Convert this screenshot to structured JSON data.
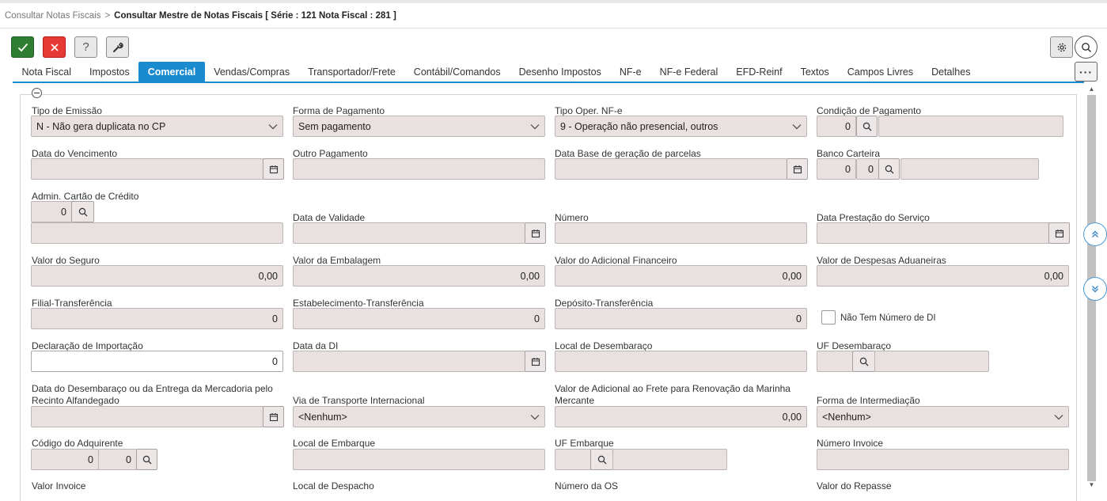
{
  "breadcrumb": {
    "parent": "Consultar Notas Fiscais",
    "separator": ">",
    "current": "Consultar Mestre de Notas Fiscais [ Série : 121 Nota Fiscal : 281 ]"
  },
  "toolbar": {
    "confirm_icon": "check-icon",
    "cancel_icon": "close-icon",
    "help_label": "?",
    "tool_icon": "wrench-icon",
    "settings_icon": "gear-icon",
    "search_icon": "search-icon",
    "more_label": "···",
    "colors": {
      "confirm": "#2e7d32",
      "cancel": "#e53935",
      "accent": "#1b8bd0"
    }
  },
  "tabs": [
    {
      "label": "Nota Fiscal"
    },
    {
      "label": "Impostos"
    },
    {
      "label": "Comercial",
      "active": true
    },
    {
      "label": "Vendas/Compras"
    },
    {
      "label": "Transportador/Frete"
    },
    {
      "label": "Contábil/Comandos"
    },
    {
      "label": "Desenho Impostos"
    },
    {
      "label": "NF-e"
    },
    {
      "label": "NF-e Federal"
    },
    {
      "label": "EFD-Reinf"
    },
    {
      "label": "Textos"
    },
    {
      "label": "Campos Livres"
    },
    {
      "label": "Detalhes"
    }
  ],
  "form": {
    "tipo_emissao": {
      "label": "Tipo de Emissão",
      "value": "N - Não gera duplicata no CP"
    },
    "forma_pagamento": {
      "label": "Forma de Pagamento",
      "value": "Sem pagamento"
    },
    "tipo_oper_nfe": {
      "label": "Tipo Oper. NF-e",
      "value": "9 - Operação não presencial, outros"
    },
    "condicao_pagamento": {
      "label": "Condição de Pagamento",
      "code": "0",
      "desc": ""
    },
    "data_vencimento": {
      "label": "Data do Vencimento",
      "value": ""
    },
    "outro_pagamento": {
      "label": "Outro Pagamento",
      "value": ""
    },
    "data_base_parcelas": {
      "label": "Data Base de geração de parcelas",
      "value": ""
    },
    "banco_carteira": {
      "label": "Banco Carteira",
      "banco": "0",
      "carteira": "0",
      "desc": ""
    },
    "admin_cartao": {
      "label": "Admin. Cartão de Crédito",
      "code": "0",
      "desc": ""
    },
    "data_validade": {
      "label": "Data de Validade",
      "value": ""
    },
    "numero": {
      "label": "Número",
      "value": ""
    },
    "data_prestacao": {
      "label": "Data Prestação do Serviço",
      "value": ""
    },
    "valor_seguro": {
      "label": "Valor do Seguro",
      "value": "0,00"
    },
    "valor_embalagem": {
      "label": "Valor da Embalagem",
      "value": "0,00"
    },
    "valor_adic_financeiro": {
      "label": "Valor do Adicional Financeiro",
      "value": "0,00"
    },
    "valor_despesas_aduaneiras": {
      "label": "Valor de Despesas Aduaneiras",
      "value": "0,00"
    },
    "filial_transferencia": {
      "label": "Filial-Transferência",
      "value": "0"
    },
    "estab_transferencia": {
      "label": "Estabelecimento-Transferência",
      "value": "0"
    },
    "deposito_transferencia": {
      "label": "Depósito-Transferência",
      "value": "0"
    },
    "nao_tem_numero_di": {
      "label": "Não Tem Número de DI",
      "checked": false
    },
    "declaracao_importacao": {
      "label": "Declaração de Importação",
      "value": "0"
    },
    "data_di": {
      "label": "Data da DI",
      "value": ""
    },
    "local_desembaraco": {
      "label": "Local de Desembaraço",
      "value": ""
    },
    "uf_desembaraco": {
      "label": "UF Desembaraço",
      "code": "",
      "desc": ""
    },
    "data_desembaraco": {
      "label_line1": "Data do Desembaraço ou da Entrega da Mercadoria pelo",
      "label_line2": "Recinto Alfandegado",
      "value": ""
    },
    "via_transporte": {
      "label": "Via de Transporte Internacional",
      "value": "<Nenhum>"
    },
    "valor_adic_frete": {
      "label_line1": "Valor de Adicional ao Frete para Renovação da Marinha",
      "label_line2": "Mercante",
      "value": "0,00"
    },
    "forma_intermediacao": {
      "label": "Forma de Intermediação",
      "value": "<Nenhum>"
    },
    "codigo_adquirente": {
      "label": "Código do Adquirente",
      "code1": "0",
      "code2": "0"
    },
    "local_embarque": {
      "label": "Local de Embarque",
      "value": ""
    },
    "uf_embarque": {
      "label": "UF Embarque",
      "code": "",
      "desc": ""
    },
    "numero_invoice": {
      "label": "Número Invoice",
      "value": ""
    },
    "valor_invoice": {
      "label": "Valor Invoice"
    },
    "local_despacho": {
      "label": "Local de Despacho"
    },
    "numero_os": {
      "label": "Número da OS"
    },
    "valor_repasse": {
      "label": "Valor do Repasse"
    }
  }
}
